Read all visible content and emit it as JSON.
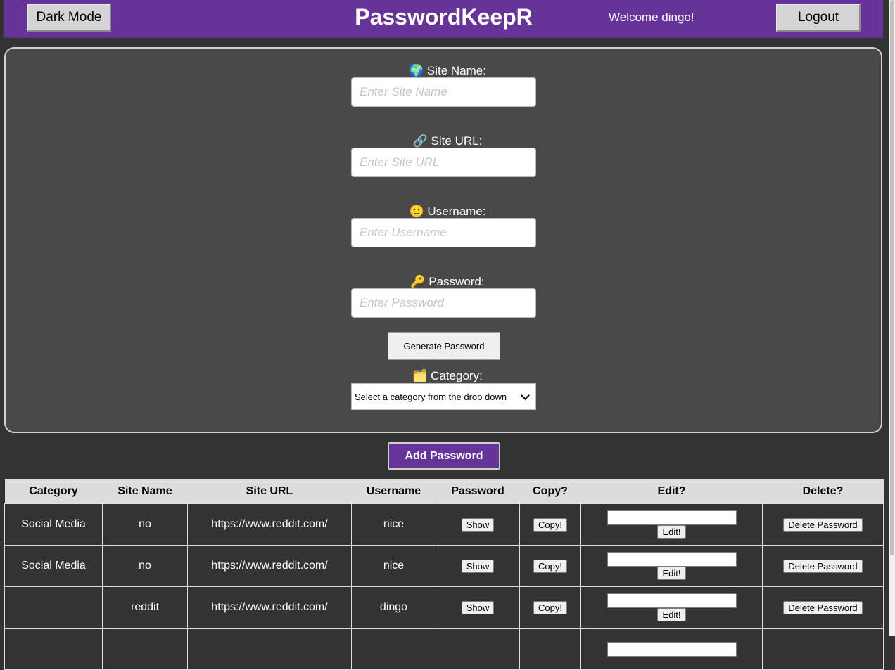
{
  "header": {
    "dark_mode_label": "Dark Mode",
    "title": "PasswordKeepR",
    "welcome": "Welcome dingo!",
    "logout_label": "Logout"
  },
  "form": {
    "site_name": {
      "label": "🌍 Site Name:",
      "placeholder": "Enter Site Name",
      "value": ""
    },
    "site_url": {
      "label": "🔗 Site URL:",
      "placeholder": "Enter Site URL",
      "value": ""
    },
    "username": {
      "label": "🙂 Username:",
      "placeholder": "Enter Username",
      "value": ""
    },
    "password": {
      "label": "🔑 Password:",
      "placeholder": "Enter Password",
      "value": ""
    },
    "generate_label": "Generate Password",
    "category": {
      "label": "🗂️ Category:",
      "selected": "Select a category from the drop down"
    },
    "add_label": "Add Password"
  },
  "table": {
    "headers": [
      "Category",
      "Site Name",
      "Site URL",
      "Username",
      "Password",
      "Copy?",
      "Edit?",
      "Delete?"
    ],
    "show_label": "Show",
    "copy_label": "Copy!",
    "edit_label": "Edit!",
    "delete_label": "Delete Password",
    "rows": [
      {
        "category": "Social Media",
        "site_name": "no",
        "site_url": "https://www.reddit.com/",
        "username": "nice"
      },
      {
        "category": "Social Media",
        "site_name": "no",
        "site_url": "https://www.reddit.com/",
        "username": "nice"
      },
      {
        "category": "",
        "site_name": "reddit",
        "site_url": "https://www.reddit.com/",
        "username": "dingo"
      }
    ]
  },
  "colors": {
    "brand": "#663399",
    "background": "#333333",
    "panel": "#494949"
  }
}
